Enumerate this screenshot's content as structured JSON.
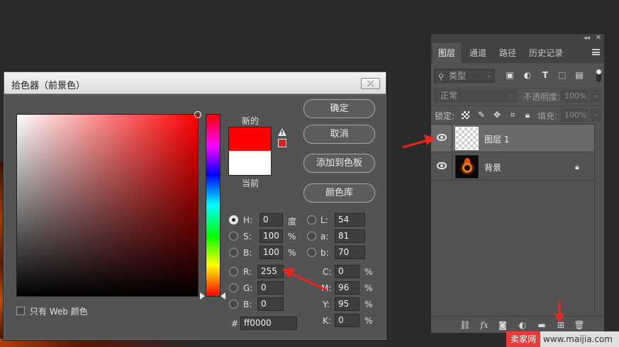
{
  "color_picker": {
    "title": "拾色器（前景色）",
    "close_label": "⤫",
    "new_label": "新的",
    "current_label": "当前",
    "new_color": "#ff0000",
    "current_color": "#ffffff",
    "buttons": [
      "确定",
      "取消",
      "添加到色板",
      "颜色库"
    ],
    "hsb": [
      {
        "label": "H:",
        "value": "0",
        "unit": "度",
        "checked": true
      },
      {
        "label": "S:",
        "value": "100",
        "unit": "%",
        "checked": false
      },
      {
        "label": "B:",
        "value": "100",
        "unit": "%",
        "checked": false
      }
    ],
    "rgb": [
      {
        "label": "R:",
        "value": "255"
      },
      {
        "label": "G:",
        "value": "0"
      },
      {
        "label": "B:",
        "value": "0"
      }
    ],
    "lab": [
      {
        "label": "L:",
        "value": "54"
      },
      {
        "label": "a:",
        "value": "81"
      },
      {
        "label": "b:",
        "value": "70"
      }
    ],
    "cmyk": [
      {
        "label": "C:",
        "value": "0",
        "unit": "%"
      },
      {
        "label": "M:",
        "value": "96",
        "unit": "%"
      },
      {
        "label": "Y:",
        "value": "95",
        "unit": "%"
      },
      {
        "label": "K:",
        "value": "0",
        "unit": "%"
      }
    ],
    "hex_label": "#",
    "hex_value": "ff0000",
    "web_only_label": "只有 Web 颜色"
  },
  "layers_panel": {
    "tabs": [
      "图层",
      "通道",
      "路径",
      "历史记录"
    ],
    "active_tab": "图层",
    "kind_filter": "类型",
    "blend_mode": "正常",
    "opacity_label": "不透明度:",
    "opacity_value": "100%",
    "lock_label": "锁定:",
    "fill_label": "填充:",
    "fill_value": "100%",
    "layers": [
      {
        "name": "图层 1",
        "selected": true,
        "thumbnail": "transparent-checker"
      },
      {
        "name": "背景",
        "selected": false,
        "thumbnail": "fire-ring",
        "locked": true
      }
    ],
    "bottom_icons": [
      "link-icon",
      "fx-icon",
      "mask-icon",
      "adjustment-icon",
      "folder-icon",
      "new-layer-icon",
      "trash-icon"
    ]
  },
  "watermark": {
    "brand": "卖家网",
    "url": "www.maijia.com"
  },
  "colors": {
    "annotation_arrow": "#e8261e",
    "dialog_bg": "#535353",
    "app_bg": "#2b2b2b"
  }
}
